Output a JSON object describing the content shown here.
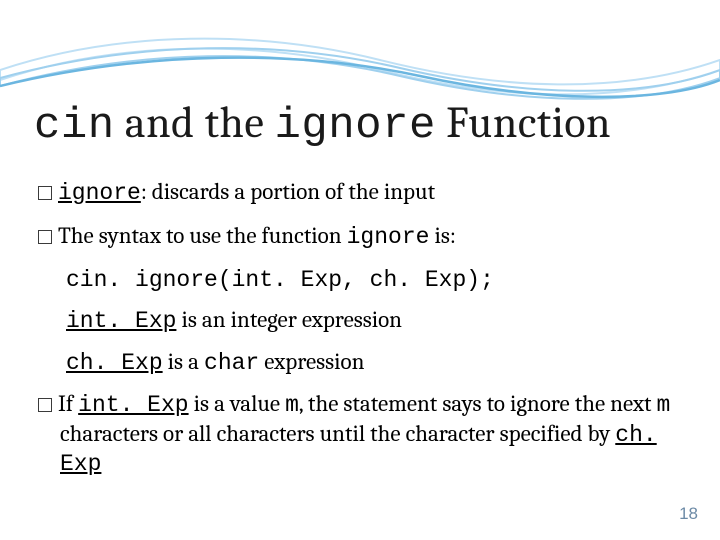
{
  "title": {
    "t1": "cin",
    "t2": " and the ",
    "t3": "ignore",
    "t4": " Function"
  },
  "bullets": {
    "b1a": "ignore",
    "b1b": ": discards a portion of the input",
    "b2a": "The syntax to use the function ",
    "b2b": "ignore",
    "b2c": " is:",
    "code": "cin. ignore(int. Exp, ch. Exp);",
    "s1a": "int. Exp",
    "s1b": " is an integer expression",
    "s2a": "ch. Exp",
    "s2b": " is a ",
    "s2c": "char",
    "s2d": " expression",
    "b3a": "If ",
    "b3b": "int. Exp",
    "b3c": " is a value ",
    "b3d": "m",
    "b3e": ", the statement says to ignore the next ",
    "b3f": "m",
    "b3g": " characters or all characters until the character specified by ",
    "b3h": "ch. Exp"
  },
  "page": "18"
}
